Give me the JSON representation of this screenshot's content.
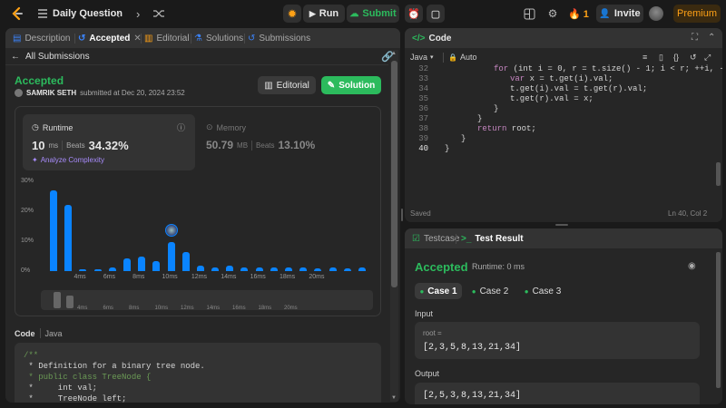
{
  "topbar": {
    "title": "Daily Question",
    "run_label": "Run",
    "submit_label": "Submit",
    "streak": "1",
    "invite_label": "Invite",
    "premium_label": "Premium"
  },
  "left_tabs": [
    {
      "label": "Description"
    },
    {
      "label": "Accepted"
    },
    {
      "label": "Editorial"
    },
    {
      "label": "Solutions"
    },
    {
      "label": "Submissions"
    }
  ],
  "submission": {
    "back_label": "All Submissions",
    "status": "Accepted",
    "user": "SAMRIK SETH",
    "submitted_text": "submitted at Dec 20, 2024 23:52",
    "editorial_btn": "Editorial",
    "solution_btn": "Solution"
  },
  "runtime": {
    "label": "Runtime",
    "value": "10",
    "unit": "ms",
    "beats_label": "Beats",
    "beats": "34.32%",
    "analyze": "Analyze Complexity"
  },
  "memory": {
    "label": "Memory",
    "value": "50.79",
    "unit": "MB",
    "beats_label": "Beats",
    "beats": "13.10%"
  },
  "chart_data": {
    "type": "bar",
    "y_ticks": [
      "30%",
      "20%",
      "10%",
      "0%"
    ],
    "ylim": [
      0,
      30
    ],
    "x_ticks": [
      "4ms",
      "6ms",
      "8ms",
      "10ms",
      "12ms",
      "14ms",
      "16ms",
      "18ms",
      "20ms"
    ],
    "values": [
      27,
      22,
      0.6,
      0.6,
      1.2,
      4.2,
      4.8,
      3.2,
      9.8,
      6.3,
      1.8,
      1.2,
      1.8,
      1.2,
      1.2,
      1.2,
      1.2,
      1.2,
      1.0,
      1.2,
      1.0,
      1.2
    ],
    "highlight_index": 8,
    "color": "#0a84ff"
  },
  "mini_ticks": [
    "4ms",
    "6ms",
    "8ms",
    "10ms",
    "12ms",
    "14ms",
    "16ms",
    "18ms",
    "20ms"
  ],
  "code_preview": {
    "header": "Code",
    "lang": "Java",
    "lines": [
      "/**",
      " * Definition for a binary tree node.",
      " * public class TreeNode {",
      " *     int val;",
      " *     TreeNode left;"
    ]
  },
  "editor": {
    "title": "Code",
    "lang": "Java",
    "mode": "Auto",
    "status_left": "Saved",
    "status_right": "Ln 40, Col 2",
    "lines": [
      {
        "n": "32",
        "indent": 2,
        "text": "for (int i = 0, r = t.size() - 1; i < r; ++i, --r) {"
      },
      {
        "n": "33",
        "indent": 3,
        "text": "var x = t.get(i).val;"
      },
      {
        "n": "34",
        "indent": 3,
        "text": "t.get(i).val = t.get(r).val;"
      },
      {
        "n": "35",
        "indent": 3,
        "text": "t.get(r).val = x;"
      },
      {
        "n": "36",
        "indent": 2,
        "text": "}"
      },
      {
        "n": "37",
        "indent": 1,
        "text": "}"
      },
      {
        "n": "38",
        "indent": 1,
        "text": "return root;"
      },
      {
        "n": "39",
        "indent": 0,
        "text": "}"
      },
      {
        "n": "40",
        "indent": -1,
        "text": "}"
      }
    ]
  },
  "test": {
    "tab_testcase": "Testcase",
    "tab_result": "Test Result",
    "status": "Accepted",
    "runtime_text": "Runtime: 0 ms",
    "cases": [
      "Case 1",
      "Case 2",
      "Case 3"
    ],
    "input_label": "Input",
    "var_name": "root =",
    "input_value": "[2,3,5,8,13,21,34]",
    "output_label": "Output",
    "output_value": "[2,5,3,8,13,21,34]"
  },
  "colors": {
    "accent_green": "#2cbb5d",
    "accent_blue": "#0a84ff",
    "premium": "#ffa116",
    "background": "#1a1a1a",
    "panel": "#262626"
  }
}
